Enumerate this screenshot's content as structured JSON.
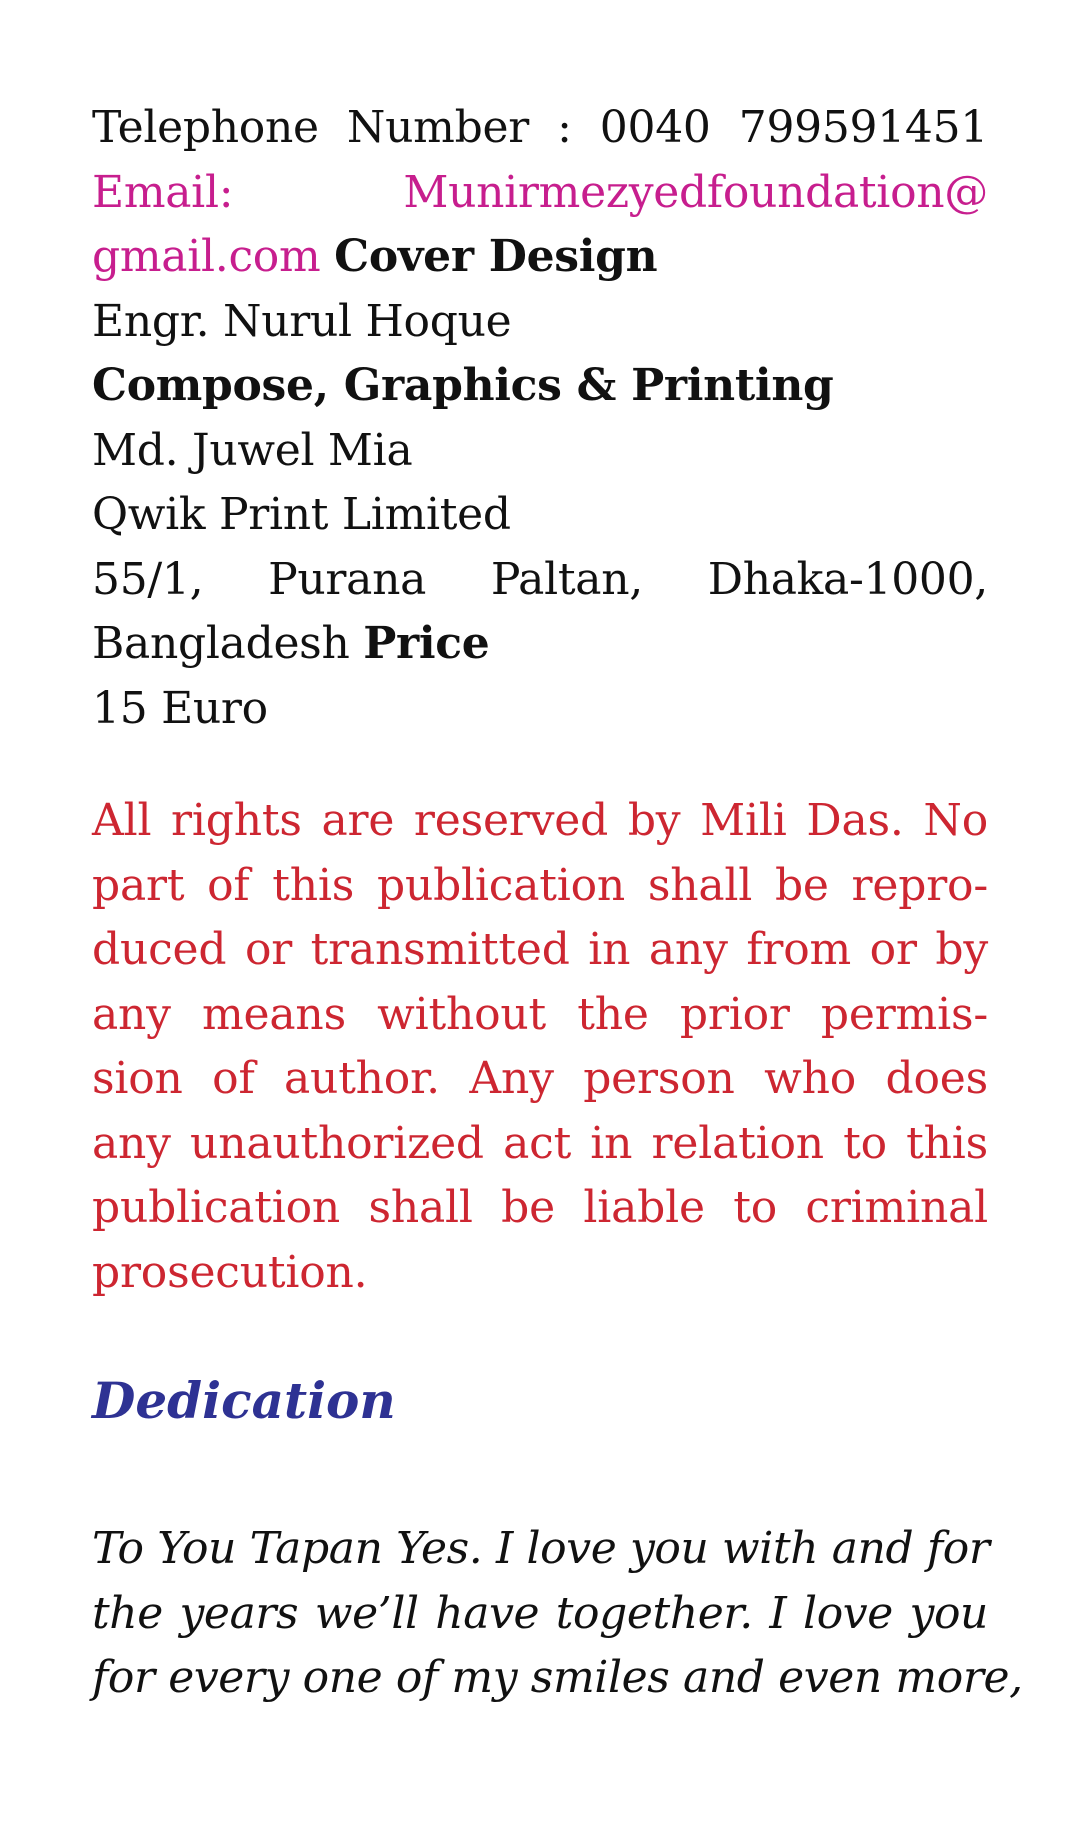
{
  "imprint": {
    "telephone": "Telephone Number : 0040 799591451",
    "email_label": "Email:",
    "email_part1": "Munirmezyedfoundation@",
    "email_part2": "gmail.com",
    "cover_design_heading": "Cover Design",
    "cover_designer": "Engr. Nurul Hoque",
    "compose_heading": "Compose, Graphics & Printing",
    "composer": "Md. Juwel Mia",
    "printer": "Qwik Print Limited",
    "address_line1": "55/1, Purana Paltan, Dhaka-1000,",
    "address_line2": "Bangladesh",
    "price_heading": "Price",
    "price": "15 Euro"
  },
  "rights": {
    "lines": [
      "All rights are reserved by Mili Das. No",
      "part of this publication shall be repro-",
      "duced or transmitted in any from or by",
      "any means without the prior permis-",
      "sion of author. Any person who does",
      "any unauthorized act in relation to this",
      "publication shall be liable to criminal",
      "prosecution."
    ]
  },
  "dedication": {
    "title": "Dedication",
    "lines": [
      "To You Tapan Yes. I love you with and for",
      "the years we’ll have together. I love you",
      "for every one of my smiles and even more,"
    ]
  },
  "colors": {
    "email": "#c71e8e",
    "rights": "#cd2631",
    "dedication_title": "#2e3293",
    "text": "#111111"
  }
}
